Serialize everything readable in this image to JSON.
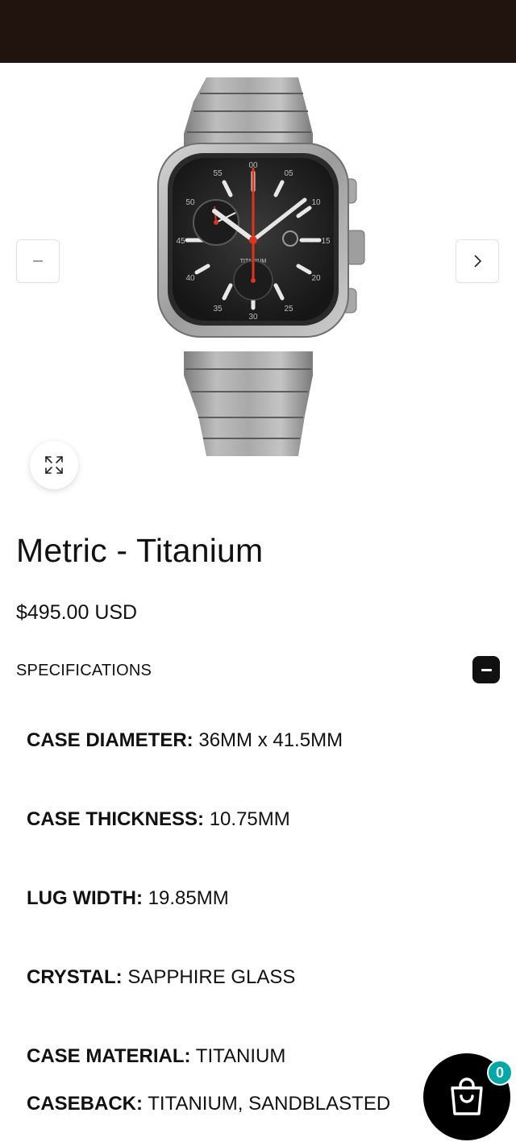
{
  "product": {
    "title": "Metric - Titanium",
    "price": "$495.00 USD"
  },
  "gallery": {
    "image_name": "watch-image",
    "prev_icon": "minus-icon",
    "next_icon": "chevron-right-icon",
    "zoom_icon": "expand-icon",
    "dial_numbers": [
      "00",
      "05",
      "10",
      "15",
      "20",
      "25",
      "30",
      "35",
      "40",
      "45",
      "50",
      "55"
    ],
    "dial_text": "TITANIUM"
  },
  "specifications": {
    "header": "SPECIFICATIONS",
    "toggle_icon": "minus-icon",
    "items": [
      {
        "label": "CASE DIAMETER:",
        "value": "36MM x 41.5MM"
      },
      {
        "label": "CASE THICKNESS:",
        "value": "10.75MM"
      },
      {
        "label": "LUG WIDTH:",
        "value": "19.85MM"
      },
      {
        "label": "CRYSTAL:",
        "value": "SAPPHIRE GLASS"
      },
      {
        "label": "CASE MATERIAL:",
        "value": "TITANIUM"
      },
      {
        "label": "CASEBACK:",
        "value": "TITANIUM, SANDBLASTED"
      }
    ]
  },
  "cart": {
    "icon": "shopping-bag-icon",
    "count": "0"
  },
  "colors": {
    "topbar": "#21140e",
    "accent_hand": "#e0321c",
    "badge": "#00a8a8"
  }
}
